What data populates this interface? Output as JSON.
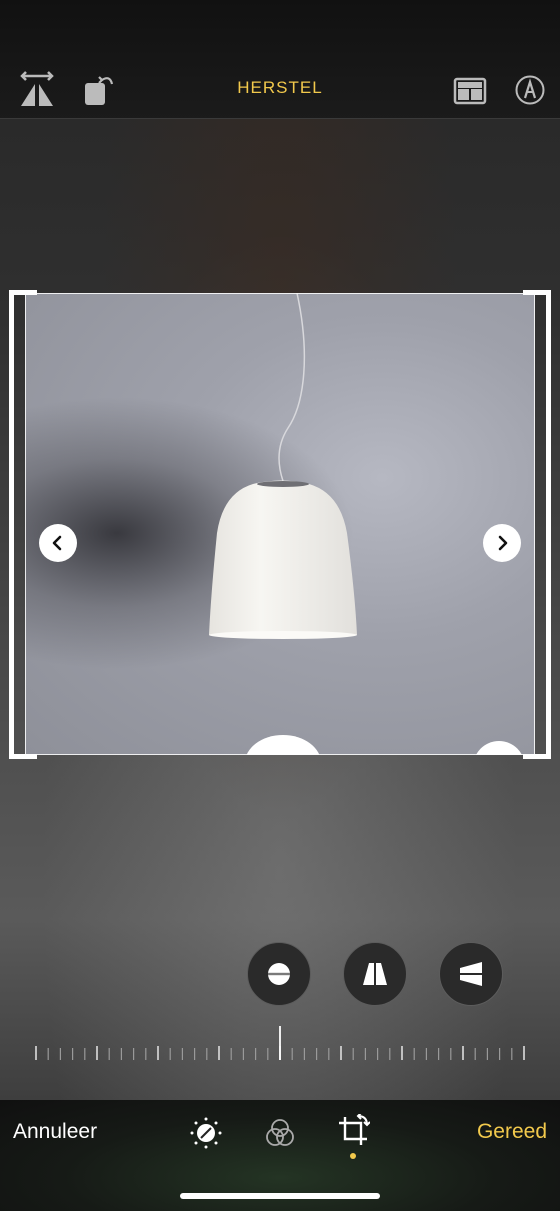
{
  "toolbar": {
    "reset_label": "HERSTEL",
    "icons": [
      "flip-horizontal-icon",
      "rotate-icon",
      "aspect-ratio-icon",
      "markup-icon"
    ]
  },
  "photo": {
    "subject": "white pendant lamp",
    "nav_left_icon": "chevron-left-icon",
    "nav_right_icon": "chevron-right-icon"
  },
  "adjust_modes": [
    "straighten-icon",
    "vertical-perspective-icon",
    "horizontal-perspective-icon"
  ],
  "straighten_dial": {
    "value": 0
  },
  "bottom_bar": {
    "cancel_label": "Annuleer",
    "done_label": "Gereed",
    "tabs": [
      "adjust-icon",
      "filters-icon",
      "crop-icon"
    ],
    "active_tab": "crop-icon"
  },
  "colors": {
    "accent": "#f2c94c",
    "background": "#141414",
    "text": "#ffffff"
  }
}
